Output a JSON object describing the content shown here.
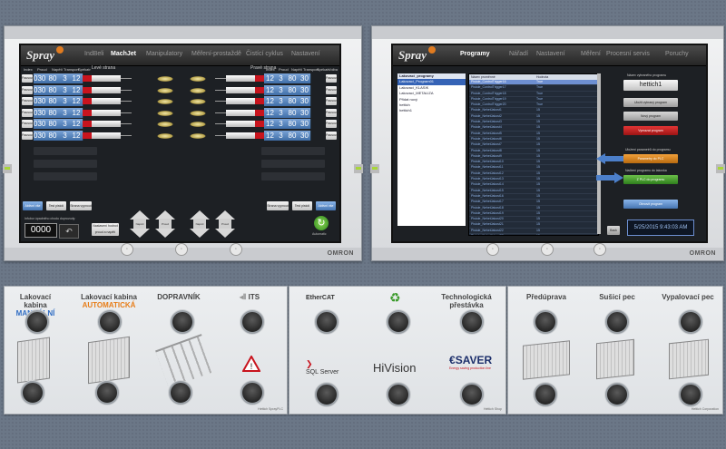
{
  "left_hmi": {
    "app_name": "Spray",
    "tabs": [
      "IndBeli",
      "MachJet",
      "Manipulatory",
      "Měření-prostaždě",
      "Čistící cyklus",
      "Nastavení"
    ],
    "active_tab": "MachJet",
    "left_header": [
      "Index",
      "Proud",
      "Napětí",
      "Transport",
      "Spékatr",
      "Levé strana"
    ],
    "right_header": [
      "Pravé strana",
      "Index",
      "Proud",
      "Napětí",
      "Transport",
      "Spékatr",
      "Volba"
    ],
    "row_button": "Pausovat",
    "rows_left": [
      [
        "030",
        "80",
        "3",
        "12"
      ],
      [
        "030",
        "80",
        "3",
        "12"
      ],
      [
        "030",
        "80",
        "3",
        "12"
      ],
      [
        "030",
        "80",
        "3",
        "12"
      ],
      [
        "030",
        "80",
        "3",
        "12"
      ],
      [
        "030",
        "80",
        "3",
        "12"
      ]
    ],
    "rows_right": [
      [
        "12",
        "3",
        "80",
        "30"
      ],
      [
        "12",
        "3",
        "80",
        "30"
      ],
      [
        "12",
        "3",
        "80",
        "30"
      ],
      [
        "12",
        "3",
        "80",
        "30"
      ],
      [
        "12",
        "3",
        "80",
        "30"
      ],
      [
        "12",
        "3",
        "80",
        "30"
      ]
    ],
    "bottom_left_buttons": [
      "Aktivní vše",
      "Test pistolí",
      "Strana vypnout"
    ],
    "bottom_right_buttons": [
      "Strana vypnout",
      "Test pistolí",
      "Aktivní vše"
    ],
    "counter_label": "Infobor úpadného chodu doprovody:",
    "counter_value": "0000",
    "reset_label": "Nastavení hodnot proud a napětí",
    "arrow_labels": [
      "Napětí",
      "Proud",
      "Napětí",
      "Proud"
    ],
    "auto_label": "Automatic"
  },
  "right_hmi": {
    "app_name": "Spray",
    "tabs": [
      "Programy",
      "Nářadí",
      "Nastavení",
      "Měření",
      "Procesní servis",
      "Poruchy"
    ],
    "active_tab": "Programy",
    "programs_header": "Lakovací_programy",
    "programs": [
      "Lakovací_Program01",
      "Lakovací_KLASIK",
      "Lakovací_METALIZA",
      "Přidat nový",
      "hettich",
      "hettich1"
    ],
    "table_headers": [
      "Název proměnné",
      "Hodnota"
    ],
    "table_rows": [
      [
        "Pistole_ControlTrigger16",
        "True"
      ],
      [
        "Pistole_ControlTrigger17",
        "True"
      ],
      [
        "Pistole_ControlTrigger18",
        "True"
      ],
      [
        "Pistole_ControlTrigger19",
        "True"
      ],
      [
        "Pistole_ControlTrigger20",
        "True"
      ],
      [
        "Pistole_NehetJakost1",
        "15"
      ],
      [
        "Pistole_NehetJakost2",
        "15"
      ],
      [
        "Pistole_NehetJakost3",
        "15"
      ],
      [
        "Pistole_NehetJakost4",
        "15"
      ],
      [
        "Pistole_NehetJakost5",
        "15"
      ],
      [
        "Pistole_NehetJakost6",
        "15"
      ],
      [
        "Pistole_NehetJakost7",
        "15"
      ],
      [
        "Pistole_NehetJakost8",
        "15"
      ],
      [
        "Pistole_NehetJakost9",
        "15"
      ],
      [
        "Pistole_NehetJakost10",
        "15"
      ],
      [
        "Pistole_NehetJakost11",
        "15"
      ],
      [
        "Pistole_NehetJakost12",
        "15"
      ],
      [
        "Pistole_NehetJakost13",
        "15"
      ],
      [
        "Pistole_NehetJakost14",
        "15"
      ],
      [
        "Pistole_NehetJakost15",
        "15"
      ],
      [
        "Pistole_NehetJakost16",
        "15"
      ],
      [
        "Pistole_NehetJakost17",
        "15"
      ],
      [
        "Pistole_NehetJakost18",
        "15"
      ],
      [
        "Pistole_NehetJakost19",
        "15"
      ],
      [
        "Pistole_NehetJakost20",
        "15"
      ],
      [
        "Pistole_NehetJakost21",
        "15"
      ],
      [
        "Pistole_NehetJakost22",
        "15"
      ],
      [
        "Pistole_NehetJakost23",
        "15"
      ],
      [
        "Pistole_NehetJakost24",
        "15"
      ],
      [
        "Pistole_NehetJakost25",
        "15"
      ],
      [
        "Pistole_NehetJakost26",
        "15"
      ]
    ],
    "highlighted_row": 0,
    "name_label": "Název vybraného programu",
    "name_value": "hettich1",
    "btn_new": "Uložit vybraný program",
    "btn_copy": "Nový program",
    "btn_delete": "Vymazat program",
    "download_label": "Uložení parametrů do programu",
    "btn_upload": "Parametry do PLC",
    "load_label": "Načtení programu do lakovka",
    "btn_load": "Z PLC do programu",
    "btn_restore": "Obnovit program",
    "back_label": "Back",
    "datetime": "5/25/2015 9:43:03 AM"
  },
  "panel1": {
    "labels": [
      [
        "Lakovací kabina",
        "MANUÁLNÍ"
      ],
      [
        "Lakovací kabina",
        "AUTOMATICKÁ"
      ],
      [
        "DOPRAVNÍK"
      ],
      [
        "ITS"
      ]
    ],
    "footer": "Hettich SprayPLC"
  },
  "panel2": {
    "labels": [
      "EtherCAT",
      "recycle-icon",
      "Technologická přestávka",
      "SQL Server",
      "HiVision",
      "SAVER"
    ],
    "saver_sub": "Energy saving production line",
    "footer": "Hettich Shop"
  },
  "panel3": {
    "labels": [
      "Předúprava",
      "Sušicí pec",
      "Vypalovací pec"
    ],
    "footer": "Hettich Corporation"
  },
  "brand": "OMRON",
  "colors": {
    "accent_blue": "#4675b2",
    "alarm_red": "#c8141e",
    "ok_green": "#2f7f1d",
    "warn_orange": "#e77d18"
  }
}
